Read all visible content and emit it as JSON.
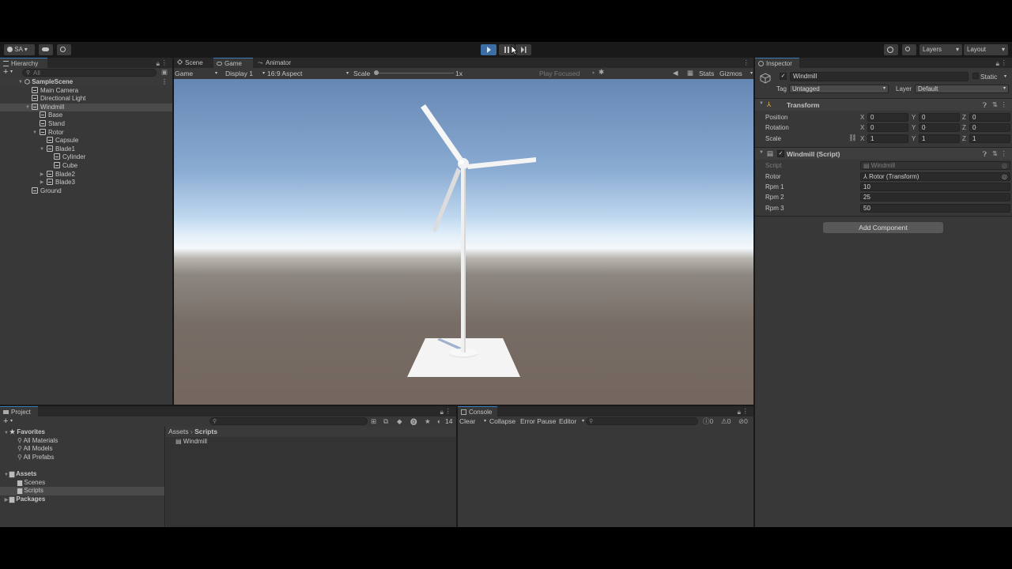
{
  "toolbar": {
    "account": "SA",
    "layers": "Layers",
    "layout": "Layout"
  },
  "hierarchy": {
    "tab": "Hierarchy",
    "search_placeholder": "All",
    "items": [
      {
        "label": "SampleScene"
      },
      {
        "label": "Main Camera"
      },
      {
        "label": "Directional Light"
      },
      {
        "label": "Windmill"
      },
      {
        "label": "Base"
      },
      {
        "label": "Stand"
      },
      {
        "label": "Rotor"
      },
      {
        "label": "Capsule"
      },
      {
        "label": "Blade1"
      },
      {
        "label": "Cylinder"
      },
      {
        "label": "Cube"
      },
      {
        "label": "Blade2"
      },
      {
        "label": "Blade3"
      },
      {
        "label": "Ground"
      }
    ]
  },
  "center": {
    "tabs": [
      "Scene",
      "Game",
      "Animator"
    ],
    "game_dropdown": "Game",
    "display": "Display 1",
    "aspect": "16:9 Aspect",
    "scale_label": "Scale",
    "scale_value": "1x",
    "play_focused": "Play Focused",
    "stats": "Stats",
    "gizmos": "Gizmos"
  },
  "inspector": {
    "tab": "Inspector",
    "object_name": "Windmill",
    "static_label": "Static",
    "tag_label": "Tag",
    "tag_value": "Untagged",
    "layer_label": "Layer",
    "layer_value": "Default",
    "transform_title": "Transform",
    "position_label": "Position",
    "rotation_label": "Rotation",
    "scale_label": "Scale",
    "position": {
      "x": "0",
      "y": "0",
      "z": "0"
    },
    "rotation": {
      "x": "0",
      "y": "0",
      "z": "0"
    },
    "scale": {
      "x": "1",
      "y": "1",
      "z": "1"
    },
    "axis_x": "X",
    "axis_y": "Y",
    "axis_z": "Z",
    "script_title": "Windmill (Script)",
    "script_label": "Script",
    "script_value": "Windmill",
    "rotor_label": "Rotor",
    "rotor_value": "Rotor (Transform)",
    "rpm1_label": "Rpm 1",
    "rpm1_value": "10",
    "rpm2_label": "Rpm 2",
    "rpm2_value": "25",
    "rpm3_label": "Rpm 3",
    "rpm3_value": "50",
    "add_component": "Add Component"
  },
  "project": {
    "tab": "Project",
    "favorites": "Favorites",
    "fav_items": [
      "All Materials",
      "All Models",
      "All Prefabs"
    ],
    "assets": "Assets",
    "asset_items": [
      "Scenes",
      "Scripts"
    ],
    "packages": "Packages",
    "breadcrumb_root": "Assets",
    "breadcrumb_sep": "›",
    "breadcrumb_current": "Scripts",
    "file": "Windmill",
    "hidden_count": "14"
  },
  "console": {
    "tab": "Console",
    "clear": "Clear",
    "collapse": "Collapse",
    "error_pause": "Error Pause",
    "editor": "Editor",
    "log_count": "0",
    "warn_count": "0",
    "error_count": "0"
  }
}
